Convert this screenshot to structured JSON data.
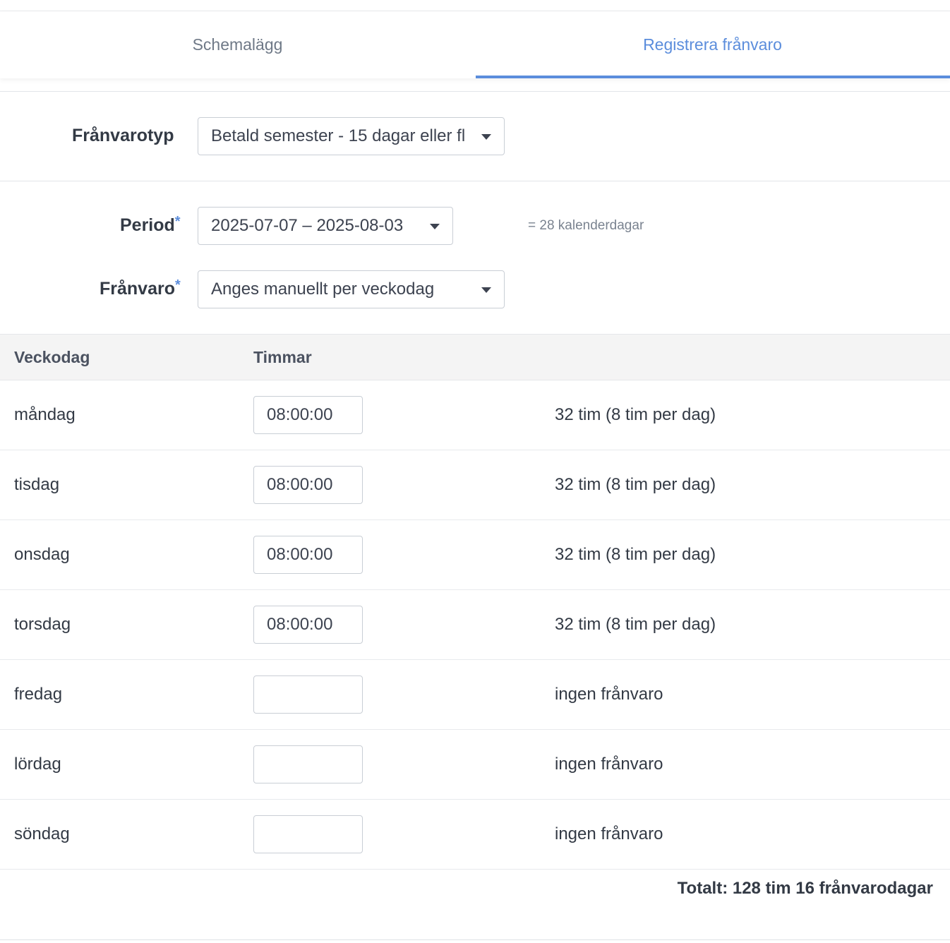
{
  "tabs": [
    {
      "label": "Schemalägg",
      "active": false
    },
    {
      "label": "Registrera frånvaro",
      "active": true
    }
  ],
  "accent_color": "#5b8ddc",
  "form": {
    "absence_type": {
      "label": "Frånvarotyp",
      "value": "Betald semester - 15 dagar eller fl"
    },
    "period": {
      "label": "Period",
      "required_mark": "*",
      "value": "2025-07-07 – 2025-08-03",
      "hint": "= 28 kalenderdagar"
    },
    "absence": {
      "label": "Frånvaro",
      "required_mark": "*",
      "value": "Anges manuellt per veckodag"
    }
  },
  "table": {
    "headers": {
      "weekday": "Veckodag",
      "hours": "Timmar"
    },
    "rows": [
      {
        "day": "måndag",
        "hours": "08:00:00",
        "summary": "32 tim (8 tim per dag)"
      },
      {
        "day": "tisdag",
        "hours": "08:00:00",
        "summary": "32 tim (8 tim per dag)"
      },
      {
        "day": "onsdag",
        "hours": "08:00:00",
        "summary": "32 tim (8 tim per dag)"
      },
      {
        "day": "torsdag",
        "hours": "08:00:00",
        "summary": "32 tim (8 tim per dag)"
      },
      {
        "day": "fredag",
        "hours": "",
        "summary": "ingen frånvaro"
      },
      {
        "day": "lördag",
        "hours": "",
        "summary": "ingen frånvaro"
      },
      {
        "day": "söndag",
        "hours": "",
        "summary": "ingen frånvaro"
      }
    ]
  },
  "total": "Totalt: 128 tim 16 frånvarodagar",
  "icons": {
    "dropdown": "caret-down-icon"
  }
}
